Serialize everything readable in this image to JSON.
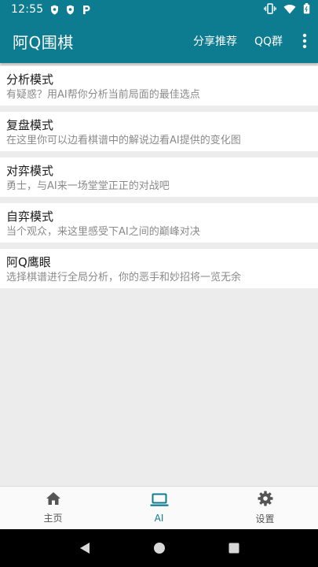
{
  "status_bar": {
    "time": "12:55",
    "left_icons": [
      "shield-icon",
      "shield-icon",
      "p-app-icon"
    ],
    "right_icons": [
      "vibrate-icon",
      "wifi-icon",
      "battery-icon"
    ]
  },
  "app_bar": {
    "title": "阿Q围棋",
    "actions": [
      "分享推荐",
      "QQ群"
    ],
    "bg_color": "#0e7c90"
  },
  "modes": [
    {
      "title": "分析模式",
      "desc": "有疑惑？用AI帮你分析当前局面的最佳选点"
    },
    {
      "title": "复盘模式",
      "desc": "在这里你可以边看棋谱中的解说边看AI提供的变化图"
    },
    {
      "title": "对弈模式",
      "desc": "勇士，与AI来一场堂堂正正的对战吧"
    },
    {
      "title": "自弈模式",
      "desc": "当个观众，来这里感受下AI之间的巅峰对决"
    },
    {
      "title": "阿Q鹰眼",
      "desc": "选择棋谱进行全局分析，你的恶手和妙招将一览无余"
    }
  ],
  "bottom_nav": {
    "items": [
      {
        "label": "主页",
        "icon": "home-icon"
      },
      {
        "label": "AI",
        "icon": "laptop-icon"
      },
      {
        "label": "设置",
        "icon": "gear-icon"
      }
    ],
    "active": "AI"
  }
}
